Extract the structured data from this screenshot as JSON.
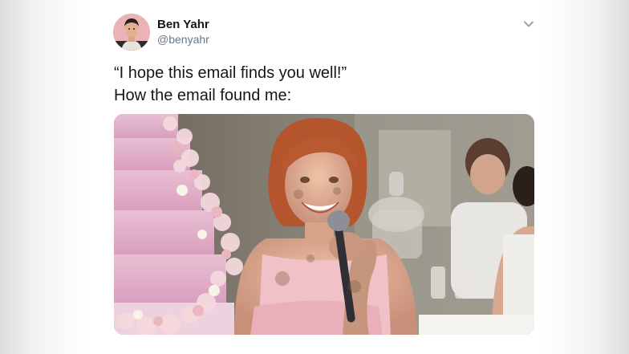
{
  "tweet": {
    "author": {
      "display_name": "Ben Yahr",
      "handle": "@benyahr",
      "avatar_icon": "profile-photo"
    },
    "menu_icon": "chevron-down-icon",
    "text_lines": [
      "“I hope this email finds you well!”",
      "How the email found me:"
    ],
    "media": {
      "kind": "photo",
      "description_icon": "meme-photo"
    }
  },
  "colors": {
    "primary_text": "#14171a",
    "secondary_text": "#657786",
    "caret": "#8899a6"
  }
}
